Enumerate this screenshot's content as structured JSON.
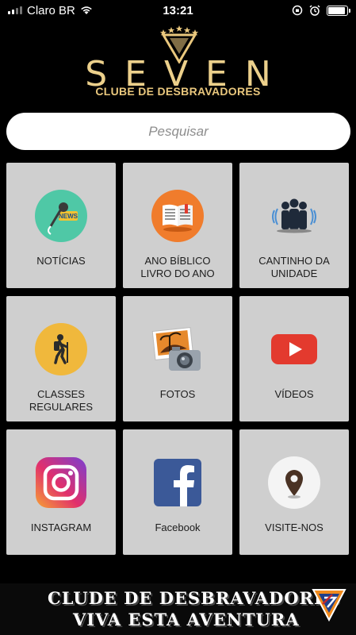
{
  "status": {
    "carrier": "Claro BR",
    "time": "13:21",
    "battery_level": 0.92
  },
  "brand": {
    "wordmark": "SEVEN",
    "subtitle": "CLUBE DE DESBRAVADORES"
  },
  "search": {
    "placeholder": "Pesquisar"
  },
  "tiles": [
    {
      "label": "NOTÍCIAS",
      "icon": "news-microphone-icon"
    },
    {
      "label": "ANO BÍBLICO\nLIVRO DO ANO",
      "icon": "open-book-icon"
    },
    {
      "label": "CANTINHO DA\nUNIDADE",
      "icon": "group-of-people-icon"
    },
    {
      "label": "CLASSES\nREGULARES",
      "icon": "hiker-icon"
    },
    {
      "label": "FOTOS",
      "icon": "photos-camera-icon"
    },
    {
      "label": "VÍDEOS",
      "icon": "youtube-play-icon"
    },
    {
      "label": "INSTAGRAM",
      "icon": "instagram-icon"
    },
    {
      "label": "Facebook",
      "icon": "facebook-icon"
    },
    {
      "label": "VISITE-NOS",
      "icon": "map-pin-icon"
    }
  ],
  "banner": {
    "line1": "CLUDE DE DESBRAVADORES",
    "line2": "VIVA ESTA AVENTURA"
  },
  "colors": {
    "gold": "#e9c77d",
    "tile": "#cfcfcf",
    "news": "#4fc8a6",
    "book": "#f07c2c",
    "hiker": "#f0b83c",
    "youtube": "#e33a2e",
    "facebook": "#3b5998"
  }
}
